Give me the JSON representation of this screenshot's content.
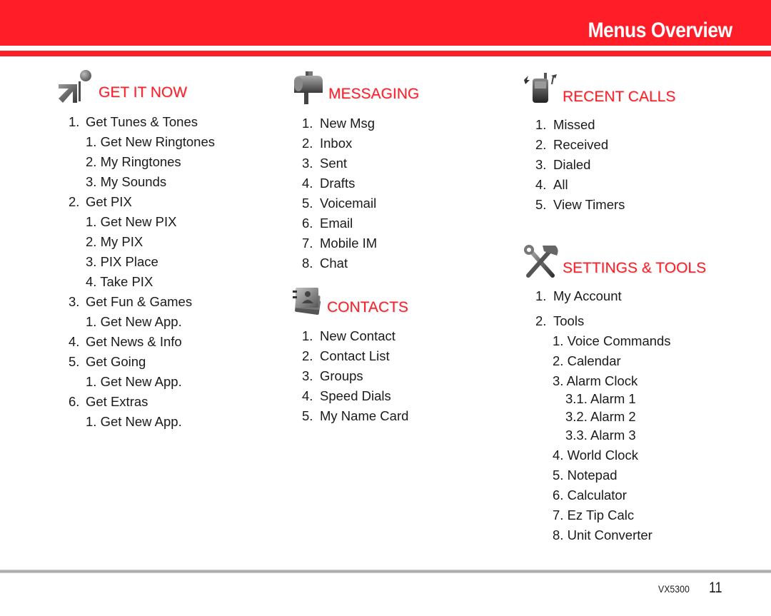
{
  "header": {
    "title": "Menus Overview",
    "brand_color": "#ff1e28"
  },
  "sections": {
    "get_it_now": {
      "title": "GET IT NOW",
      "icon": "arrow-ball-icon",
      "items": [
        {
          "num": "1.",
          "label": "Get Tunes & Tones",
          "level": 1
        },
        {
          "num": "1.",
          "label": "Get New Ringtones",
          "level": 2
        },
        {
          "num": "2.",
          "label": "My Ringtones",
          "level": 2
        },
        {
          "num": "3.",
          "label": "My Sounds",
          "level": 2
        },
        {
          "num": "2.",
          "label": "Get PIX",
          "level": 1
        },
        {
          "num": "1.",
          "label": "Get New PIX",
          "level": 2
        },
        {
          "num": "2.",
          "label": "My PIX",
          "level": 2
        },
        {
          "num": "3.",
          "label": "PIX Place",
          "level": 2
        },
        {
          "num": "4.",
          "label": "Take PIX",
          "level": 2
        },
        {
          "num": "3.",
          "label": "Get Fun & Games",
          "level": 1
        },
        {
          "num": "1.",
          "label": "Get New App.",
          "level": 2
        },
        {
          "num": "4.",
          "label": "Get News & Info",
          "level": 1
        },
        {
          "num": "5.",
          "label": "Get Going",
          "level": 1
        },
        {
          "num": "1.",
          "label": "Get New App.",
          "level": 2
        },
        {
          "num": "6.",
          "label": "Get Extras",
          "level": 1
        },
        {
          "num": "1.",
          "label": "Get New App.",
          "level": 2
        }
      ]
    },
    "messaging": {
      "title": "MESSAGING",
      "icon": "mailbox-icon",
      "items": [
        {
          "num": "1.",
          "label": "New Msg",
          "level": 1
        },
        {
          "num": "2.",
          "label": "Inbox",
          "level": 1
        },
        {
          "num": "3.",
          "label": "Sent",
          "level": 1
        },
        {
          "num": "4.",
          "label": "Drafts",
          "level": 1
        },
        {
          "num": "5.",
          "label": "Voicemail",
          "level": 1
        },
        {
          "num": "6.",
          "label": "Email",
          "level": 1
        },
        {
          "num": "7.",
          "label": "Mobile IM",
          "level": 1
        },
        {
          "num": "8.",
          "label": "Chat",
          "level": 1
        }
      ]
    },
    "contacts": {
      "title": "CONTACTS",
      "icon": "address-book-icon",
      "items": [
        {
          "num": "1.",
          "label": "New Contact",
          "level": 1
        },
        {
          "num": "2.",
          "label": "Contact List",
          "level": 1
        },
        {
          "num": "3.",
          "label": "Groups",
          "level": 1
        },
        {
          "num": "4.",
          "label": "Speed Dials",
          "level": 1
        },
        {
          "num": "5.",
          "label": "My Name Card",
          "level": 1
        }
      ]
    },
    "recent_calls": {
      "title": "RECENT CALLS",
      "icon": "phone-calls-icon",
      "items": [
        {
          "num": "1.",
          "label": "Missed",
          "level": 1
        },
        {
          "num": "2.",
          "label": "Received",
          "level": 1
        },
        {
          "num": "3.",
          "label": "Dialed",
          "level": 1
        },
        {
          "num": "4.",
          "label": "All",
          "level": 1
        },
        {
          "num": "5.",
          "label": "View Timers",
          "level": 1
        }
      ]
    },
    "settings_tools": {
      "title": "SETTINGS & TOOLS",
      "icon": "wrench-hammer-icon",
      "items": [
        {
          "num": "1.",
          "label": "My Account",
          "level": 1
        },
        {
          "num": "2.",
          "label": "Tools",
          "level": 1
        },
        {
          "num": "1.",
          "label": "Voice Commands",
          "level": 2
        },
        {
          "num": "2.",
          "label": "Calendar",
          "level": 2
        },
        {
          "num": "3.",
          "label": "Alarm Clock",
          "level": 2
        },
        {
          "num": "3.1.",
          "label": "Alarm 1",
          "level": 3
        },
        {
          "num": "3.2.",
          "label": "Alarm 2",
          "level": 3
        },
        {
          "num": "3.3.",
          "label": "Alarm 3",
          "level": 3
        },
        {
          "num": "4.",
          "label": "World Clock",
          "level": 2
        },
        {
          "num": "5.",
          "label": "Notepad",
          "level": 2
        },
        {
          "num": "6.",
          "label": "Calculator",
          "level": 2
        },
        {
          "num": "7.",
          "label": "Ez Tip Calc",
          "level": 2
        },
        {
          "num": "8.",
          "label": "Unit Converter",
          "level": 2
        }
      ]
    }
  },
  "footer": {
    "model": "VX5300",
    "page_number": "11"
  }
}
